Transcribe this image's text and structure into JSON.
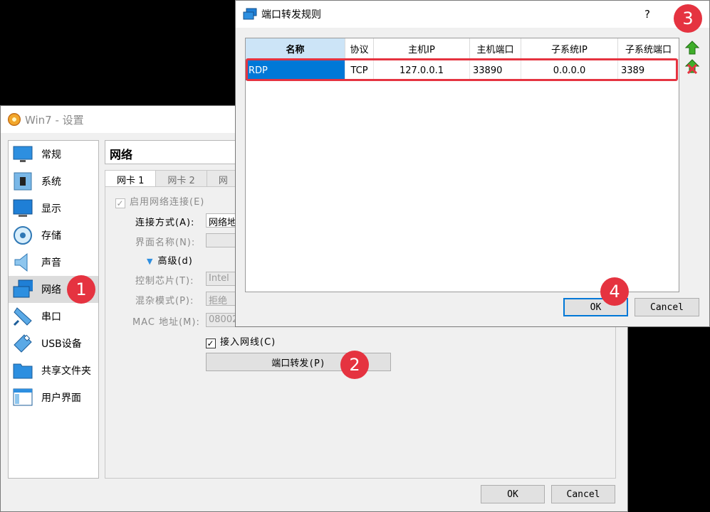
{
  "settings": {
    "title": "Win7 - 设置",
    "sidebar": [
      {
        "label": "常规",
        "icon": "monitor-icon"
      },
      {
        "label": "系统",
        "icon": "chip-icon"
      },
      {
        "label": "显示",
        "icon": "display-icon"
      },
      {
        "label": "存储",
        "icon": "disk-icon"
      },
      {
        "label": "声音",
        "icon": "speaker-icon"
      },
      {
        "label": "网络",
        "icon": "network-icon"
      },
      {
        "label": "串口",
        "icon": "serial-port-icon"
      },
      {
        "label": "USB设备",
        "icon": "usb-icon"
      },
      {
        "label": "共享文件夹",
        "icon": "folder-icon"
      },
      {
        "label": "用户界面",
        "icon": "ui-window-icon"
      }
    ],
    "section_title": "网络",
    "tabs": [
      "网卡 1",
      "网卡 2",
      "网"
    ],
    "enable_label": "启用网络连接(E)",
    "attach_label": "连接方式(A):",
    "attach_value": "网络地",
    "name_label": "界面名称(N):",
    "advanced_label": "高级(d)",
    "adapter_label": "控制芯片(T):",
    "adapter_value": "Intel",
    "promisc_label": "混杂模式(P):",
    "promisc_value": "拒绝",
    "mac_label": "MAC 地址(M):",
    "mac_value": "08002",
    "cable_label": "接入网线(C)",
    "port_forward_label": "端口转发(P)",
    "ok_label": "OK",
    "cancel_label": "Cancel"
  },
  "dialog": {
    "title": "端口转发规则",
    "help": "?",
    "columns": [
      "名称",
      "协议",
      "主机IP",
      "主机端口",
      "子系统IP",
      "子系统端口"
    ],
    "rows": [
      {
        "name": "RDP",
        "protocol": "TCP",
        "host_ip": "127.0.0.1",
        "host_port": "33890",
        "guest_ip": "0.0.0.0",
        "guest_port": "3389"
      }
    ],
    "ok_label": "OK",
    "cancel_label": "Cancel"
  },
  "markers": [
    "1",
    "2",
    "3",
    "4"
  ],
  "colors": {
    "accent": "#0078d7",
    "marker": "#e53340",
    "highlight": "#e53340"
  }
}
